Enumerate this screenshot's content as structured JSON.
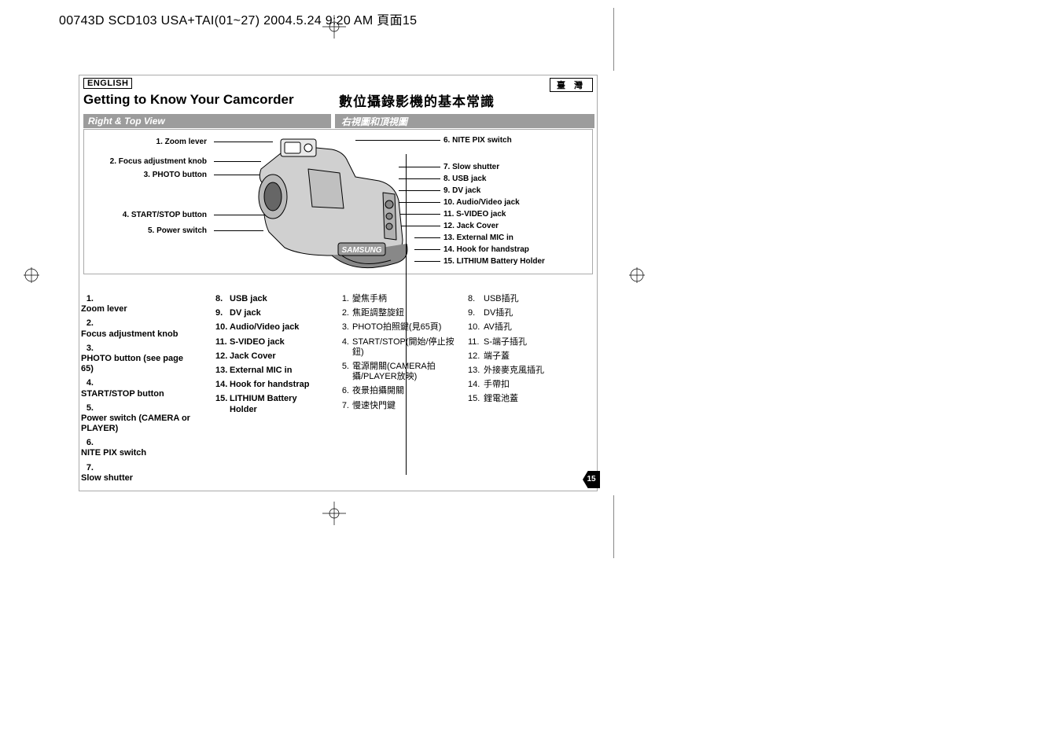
{
  "header": "00743D SCD103 USA+TAI(01~27)  2004.5.24  9:20 AM  頁面15",
  "lang_en_tag": "ENGLISH",
  "lang_tw_tag": "臺 灣",
  "title_en": "Getting to Know Your Camcorder",
  "title_tw": "數位攝錄影機的基本常識",
  "subtitle_en": "Right & Top View",
  "subtitle_tw": "右視圖和頂視圖",
  "brand": "SAMSUNG",
  "callouts_left": [
    "1. Zoom lever",
    "2. Focus adjustment knob",
    "3. PHOTO button",
    "4. START/STOP button",
    "5. Power switch"
  ],
  "callouts_right": [
    "6. NITE PIX switch",
    "7. Slow shutter",
    "8. USB jack",
    "9. DV jack",
    "10. Audio/Video jack",
    "11. S-VIDEO jack",
    "12. Jack Cover",
    "13. External MIC in",
    "14. Hook for handstrap",
    "15. LITHIUM Battery Holder"
  ],
  "en_list_1": [
    {
      "n": "1.",
      "t": "Zoom lever"
    },
    {
      "n": "2.",
      "t": "Focus adjustment knob"
    },
    {
      "n": "3.",
      "t": "PHOTO button (see page 65)"
    },
    {
      "n": "4.",
      "t": "START/STOP button"
    },
    {
      "n": "5.",
      "t": "Power switch (CAMERA or PLAYER)"
    },
    {
      "n": "6.",
      "t": "NITE PIX switch"
    },
    {
      "n": "7.",
      "t": "Slow shutter"
    }
  ],
  "en_list_2": [
    {
      "n": "8.",
      "t": "USB jack"
    },
    {
      "n": "9.",
      "t": "DV jack"
    },
    {
      "n": "10.",
      "t": "Audio/Video jack"
    },
    {
      "n": "11.",
      "t": "S-VIDEO jack"
    },
    {
      "n": "12.",
      "t": "Jack Cover"
    },
    {
      "n": "13.",
      "t": "External MIC in"
    },
    {
      "n": "14.",
      "t": "Hook for handstrap"
    },
    {
      "n": "15.",
      "t": "LITHIUM Battery Holder"
    }
  ],
  "tw_list_1": [
    {
      "n": "1.",
      "t": "變焦手柄"
    },
    {
      "n": "2.",
      "t": "焦距調整旋鈕"
    },
    {
      "n": "3.",
      "t": "PHOTO拍照鍵(見65頁)"
    },
    {
      "n": "4.",
      "t": "START/STOP(開始/停止按鈕)"
    },
    {
      "n": "5.",
      "t": "電源開關(CAMERA拍攝/PLAYER放映)"
    },
    {
      "n": "6.",
      "t": "夜景拍攝開關"
    },
    {
      "n": "7.",
      "t": "慢速快門鍵"
    }
  ],
  "tw_list_2": [
    {
      "n": "8.",
      "t": "USB插孔"
    },
    {
      "n": "9.",
      "t": "DV插孔"
    },
    {
      "n": "10.",
      "t": "AV插孔"
    },
    {
      "n": "11.",
      "t": "S-端子插孔"
    },
    {
      "n": "12.",
      "t": "端子蓋"
    },
    {
      "n": "13.",
      "t": "外接麥克風插孔"
    },
    {
      "n": "14.",
      "t": "手帶扣"
    },
    {
      "n": "15.",
      "t": "鋰電池蓋"
    }
  ],
  "page_number": "15"
}
